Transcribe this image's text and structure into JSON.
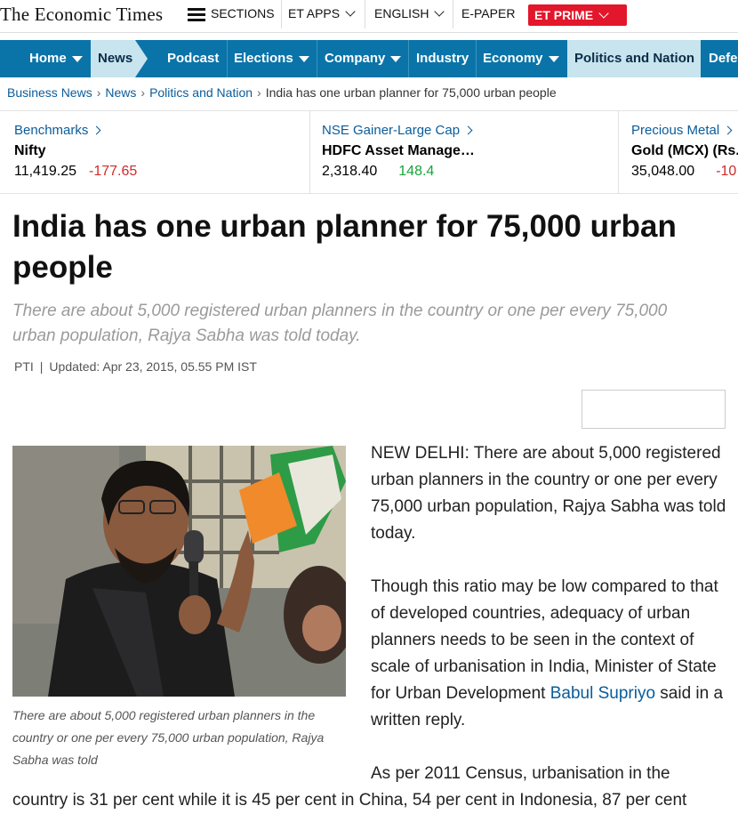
{
  "topbar": {
    "logo": "The Economic Times",
    "sections": "SECTIONS",
    "et_apps": "ET APPS",
    "language": "ENGLISH",
    "epaper": "E-PAPER",
    "prime": "ET PRIME",
    "prime_color": "#e2172b"
  },
  "nav": {
    "items": [
      "Home",
      "News",
      "Podcast",
      "Elections",
      "Company",
      "Industry",
      "Economy",
      "Politics and Nation",
      "Defe"
    ],
    "active": "News",
    "bar_color": "#0a74a9"
  },
  "breadcrumb": [
    "Business News",
    "News",
    "Politics and Nation",
    "India has one urban planner for 75,000 urban people"
  ],
  "ticker": [
    {
      "category": "Benchmarks",
      "name": "Nifty",
      "value": "11,419.25",
      "change": "-177.65",
      "direction": "down"
    },
    {
      "category": "NSE Gainer-Large Cap",
      "name": "HDFC Asset Manage…",
      "value": "2,318.40",
      "change": "148.4",
      "direction": "up"
    },
    {
      "category": "Precious Metal",
      "name": "Gold (MCX) (Rs.",
      "value": "35,048.00",
      "change": "-10",
      "direction": "down"
    }
  ],
  "article": {
    "headline": "India has one urban planner for 75,000 urban people",
    "synopsis": "There are about 5,000 registered urban planners in the country or one per every 75,000 urban population, Rajya Sabha was told today.",
    "source": "PTI",
    "updated": "Updated: Apr 23, 2015, 05.55 PM IST",
    "caption": "There are about 5,000 registered urban planners in the country or one per every 75,000 urban population, Rajya Sabha was told",
    "para1": "NEW DELHI: There are about 5,000 registered urban planners in the country or one per every 75,000 urban population, Rajya Sabha was told today.",
    "para2_text": "Though this ratio may be low compared to that of developed countries, adequacy of urban planners needs to be seen in the context of scale of urbanisation in India, Minister of State for Urban Development",
    "para2_link": "Babul Supriyo",
    "para2_end": "said in a written reply.",
    "para3_line1": "As per 2011 Census, urbanisation in the",
    "para3_line2": "country is 31 per cent while it is 45 per cent in China, 54 per cent in Indonesia, 87 per cent"
  }
}
